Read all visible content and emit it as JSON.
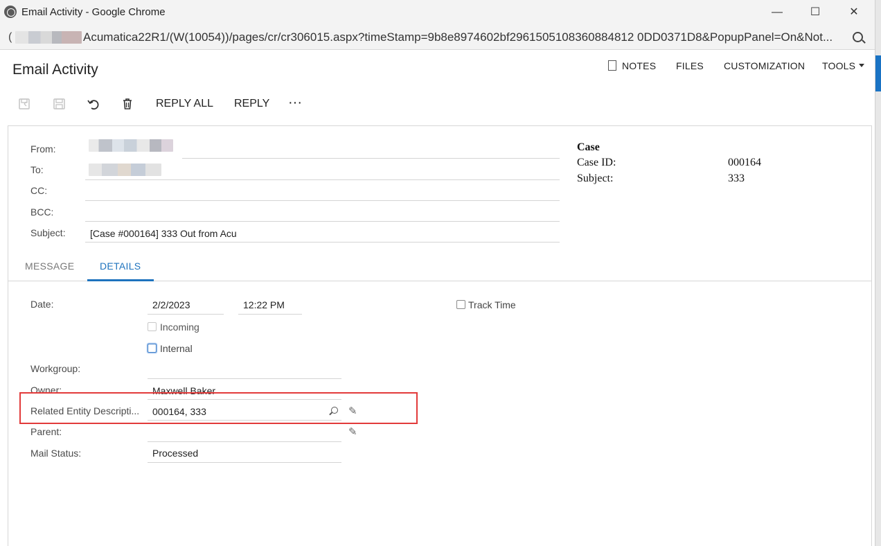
{
  "window": {
    "title": "Email Activity - Google Chrome",
    "minimize": "—",
    "maximize": "☐",
    "close": "✕"
  },
  "address": {
    "lead": "(",
    "url": "Acumatica22R1/(W(10054))/pages/cr/cr306015.aspx?timeStamp=9b8e8974602bf2961505108360884812 0DD0371D8&PopupPanel=On&Not..."
  },
  "page": {
    "title": "Email Activity",
    "links": {
      "notes": "NOTES",
      "files": "FILES",
      "customization": "CUSTOMIZATION",
      "tools": "TOOLS"
    }
  },
  "toolbar": {
    "reply_all": "REPLY ALL",
    "reply": "REPLY",
    "more": "···"
  },
  "form": {
    "from_label": "From:",
    "to_label": "To:",
    "cc_label": "CC:",
    "bcc_label": "BCC:",
    "subject_label": "Subject:",
    "subject_value": "[Case #000164] 333 Out from Acu"
  },
  "case": {
    "heading": "Case",
    "case_id_label": "Case ID:",
    "case_id_value": "000164",
    "subject_label": "Subject:",
    "subject_value": "333"
  },
  "tabs": {
    "message": "MESSAGE",
    "details": "DETAILS"
  },
  "details": {
    "date_label": "Date:",
    "date_value": "2/2/2023",
    "time_value": "12:22 PM",
    "track_time": "Track Time",
    "incoming": "Incoming",
    "internal": "Internal",
    "workgroup_label": "Workgroup:",
    "owner_label": "Owner:",
    "owner_value": "Maxwell Baker",
    "related_label": "Related Entity Descripti...",
    "related_value": "000164, 333",
    "parent_label": "Parent:",
    "mail_status_label": "Mail Status:",
    "mail_status_value": "Processed"
  }
}
